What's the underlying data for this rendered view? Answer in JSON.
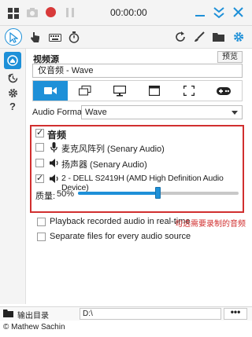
{
  "titlebar": {
    "timer": "00:00:00"
  },
  "icons": {
    "camera": "camera-icon",
    "record": "record-icon",
    "pause": "pause-icon",
    "minimize": "minimize-icon",
    "collapse": "collapse-icon",
    "close": "close-icon"
  },
  "source": {
    "heading": "视频源",
    "preview_label": "预览",
    "value": "仅音频 - Wave"
  },
  "audio_format": {
    "label": "Audio Format",
    "value": "Wave"
  },
  "audio": {
    "title": "音频",
    "devices": [
      {
        "label": "麦克风阵列 (Senary Audio)",
        "checked": false
      },
      {
        "label": "扬声器 (Senary Audio)",
        "checked": false
      },
      {
        "label": "2 - DELL S2419H (AMD High Definition Audio Device)",
        "checked": true
      }
    ],
    "quality_label": "质量:",
    "quality_value": "50%",
    "quality_level": 0.5
  },
  "options": {
    "playback": "Playback recorded audio in real-time",
    "separate": "Separate files for every audio source"
  },
  "annotation": "勾选需要录制的音频",
  "output": {
    "label": "输出目录",
    "path": "D:\\",
    "browse": "•••"
  },
  "footer": {
    "copyright": "© Mathew Sachin"
  },
  "colors": {
    "accent": "#1e90d8",
    "highlight": "#d12f2f"
  }
}
